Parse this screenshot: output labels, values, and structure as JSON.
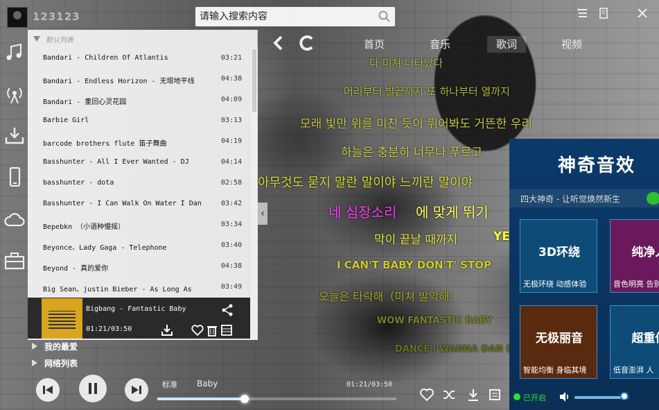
{
  "user": {
    "name": "123123"
  },
  "search": {
    "placeholder": "请输入搜索内容"
  },
  "nav": {
    "tabs": [
      "首页",
      "音乐",
      "歌词",
      "视频"
    ]
  },
  "playlist": {
    "title": "默认列表",
    "songs": [
      {
        "name": "Bandari - Children Of Atlantis",
        "dur": "03:21"
      },
      {
        "name": "Bandari - Endless Horizon - 无垠地平线",
        "dur": "04:38"
      },
      {
        "name": "Bandari - 重回心灵花园",
        "dur": "04:09"
      },
      {
        "name": "Barbie Girl",
        "dur": "03:13"
      },
      {
        "name": "barcode brothers flute 笛子舞曲",
        "dur": "04:19"
      },
      {
        "name": "Basshunter - All I Ever Wanted - DJ",
        "dur": "04:14"
      },
      {
        "name": "basshunter - dota",
        "dur": "02:58"
      },
      {
        "name": "Basshunter - I Can Walk On Water I Dan",
        "dur": "03:42"
      },
      {
        "name": "Bepebkn （小语种慢摇）",
        "dur": "03:34"
      },
      {
        "name": "Beyonce、Lady Gaga - Telephone",
        "dur": "03:40"
      },
      {
        "name": "Beyond - 真的爱你",
        "dur": "04:38"
      },
      {
        "name": "Big Sean、justin Bieber - As Long As",
        "dur": "03:49"
      }
    ]
  },
  "now_playing": {
    "title": "Bigbang - Fantastic Baby",
    "time": "01:21/03:50",
    "progress": 0.3655
  },
  "groups": [
    "我的最爱",
    "网络列表"
  ],
  "lyrics": [
    {
      "text": "다 미쳐 나타났다",
      "color": "#b3b83a"
    },
    {
      "text": "머리부터 발끝까지 또 하나부터 열까지",
      "color": "#b3b83a"
    },
    {
      "text": "모래 빛만 위를 미친 듯이 뛰어봐도 거뜬한 우리",
      "color": "#c9c94a"
    },
    {
      "text": "하늘은 충분히 너무나 푸르고",
      "color": "#cfd24a"
    },
    {
      "text": "아무것도 묻지 말란 말이야 느끼란 말이야",
      "color": "#d7da3c"
    },
    {
      "text": "네 심장소리",
      "color": "#ff3dff"
    },
    {
      "text": "에 맞게 뛰기",
      "color": "#ffff66"
    },
    {
      "text": "막이 끝날 때까지 ",
      "color": "#e5e84a"
    },
    {
      "text": "YE",
      "color": "#ffff33"
    },
    {
      "text": "I CAN'T BABY DON'T' STOP",
      "color": "#c9cc2a"
    },
    {
      "text": "오늘은 타락해（미쳐 발악해）",
      "color": "#a7aa2a"
    },
    {
      "text": "WOW FANTASTIC BABY",
      "color": "#7d7f28"
    },
    {
      "text": "DANCE I WANNA DAN DAN DAN",
      "color": "#6b6d25"
    }
  ],
  "player": {
    "quality": "标准",
    "track": "Baby",
    "time": "01:21/03:50"
  },
  "fx": {
    "title": "神奇音效",
    "subtitle": "四大神奇 - 让听觉焕然新生",
    "cards": [
      {
        "title": "3D环绕",
        "desc": "无极环绕 动感体验",
        "color": "#0e4c77"
      },
      {
        "title": "纯净人",
        "desc": "音色明亮 告别",
        "color": "#6a1a5c"
      },
      {
        "title": "无极丽音",
        "desc": "智能均衡 身临其境",
        "color": "#5a2a0e"
      },
      {
        "title": "超重低",
        "desc": "低音澎湃 人",
        "color": "#0e4c77"
      }
    ],
    "status": "已开启",
    "volume": 0.92
  },
  "icons": [
    "logo-avatar",
    "search-icon",
    "skin-icon",
    "menu-icon",
    "minimize-icon",
    "back-icon",
    "refresh-icon",
    "music-icon",
    "radio-icon",
    "download-icon",
    "phone-icon",
    "cloud-icon",
    "toolbox-icon",
    "share-icon",
    "heart-icon",
    "trash-icon",
    "mv-icon",
    "prev-icon",
    "pause-icon",
    "next-icon",
    "volume-icon",
    "shuffle-icon",
    "lyric-icon"
  ]
}
